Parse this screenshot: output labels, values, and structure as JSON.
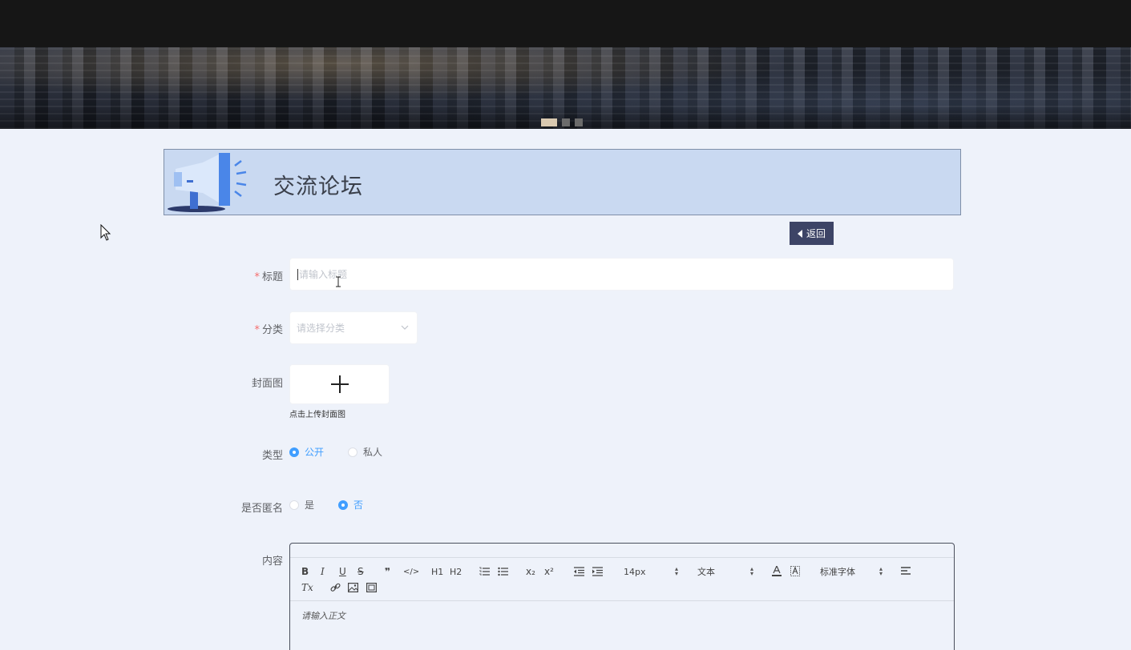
{
  "banner": {
    "slides": 3,
    "active_slide": 1
  },
  "header": {
    "title": "交流论坛"
  },
  "back_button": {
    "label": "返回"
  },
  "form": {
    "title": {
      "label": "标题",
      "required": "*",
      "placeholder": "请输入标题"
    },
    "category": {
      "label": "分类",
      "required": "*",
      "placeholder": "请选择分类"
    },
    "cover": {
      "label": "封面图",
      "hint": "点击上传封面图"
    },
    "type": {
      "label": "类型",
      "options": [
        "公开",
        "私人"
      ],
      "selected": "公开"
    },
    "anonymous": {
      "label": "是否匿名",
      "options": [
        "是",
        "否"
      ],
      "selected": "否"
    },
    "content": {
      "label": "内容",
      "placeholder": "请输入正文",
      "toolbar": {
        "size": "14px",
        "header": "文本",
        "font": "标准字体",
        "h1": "H1",
        "h2": "H2",
        "bold": "B",
        "italic": "I",
        "underline": "U",
        "strike": "S",
        "quote": "❞",
        "code": "</>",
        "sub": "x₂",
        "sup": "x²",
        "clear": "Tx"
      }
    }
  },
  "colors": {
    "accent": "#409eff",
    "header_bg": "#c9d9f1",
    "back_button_bg": "#3d4466",
    "required": "#f56c6c"
  }
}
